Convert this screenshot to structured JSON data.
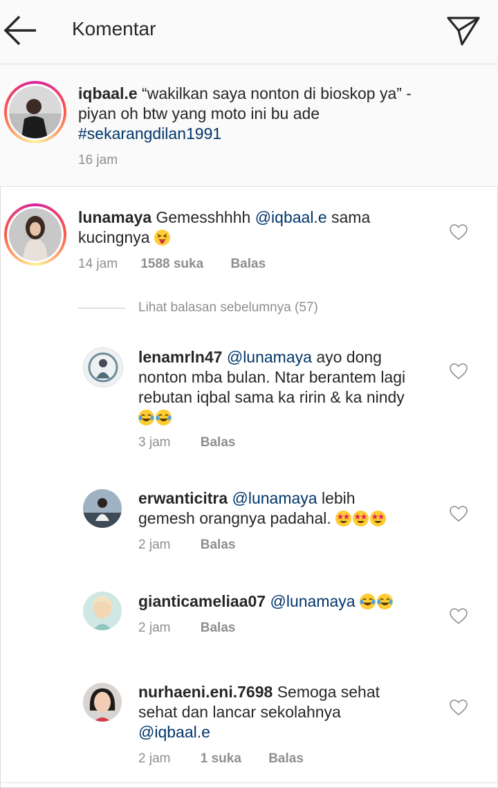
{
  "header": {
    "title": "Komentar",
    "back_icon": "arrow-left-icon",
    "share_icon": "paper-plane-icon"
  },
  "caption": {
    "username": "iqbaal.e",
    "text": "“wakilkan saya nonton di bioskop ya” -piyan oh btw yang moto ini bu ade",
    "hashtag": "#sekarangdilan1991",
    "time": "16 jam"
  },
  "comment": {
    "username": "lunamaya",
    "text_before": "Gemesshhhh",
    "mention": "@iqbaal.e",
    "text_after": "sama kucingnya",
    "emoji": "squinting-tongue-emoji",
    "time": "14 jam",
    "likes": "1588 suka",
    "reply_label": "Balas"
  },
  "view_previous_replies": "Lihat balasan sebelumnya (57)",
  "replies": [
    {
      "username": "lenamrln47",
      "mention": "@lunamaya",
      "text": "ayo dong nonton mba bulan. Ntar berantem lagi rebutan iqbal sama ka ririn & ka nindy",
      "emojis": "tears-of-joy-emoji x2",
      "time": "3 jam",
      "reply_label": "Balas"
    },
    {
      "username": "erwanticitra",
      "mention": "@lunamaya",
      "text": "lebih gemesh orangnya padahal.",
      "emojis": "star-struck-emoji x3",
      "time": "2 jam",
      "reply_label": "Balas"
    },
    {
      "username": "gianticameliaa07",
      "mention": "@lunamaya",
      "emojis": "tears-of-joy-emoji x2",
      "time": "2 jam",
      "reply_label": "Balas"
    },
    {
      "username": "nurhaeni.eni.7698",
      "text": "Semoga sehat sehat dan lancar sekolahnya",
      "mention": "@iqbaal.e",
      "time": "2 jam",
      "likes": "1 suka",
      "reply_label": "Balas"
    }
  ],
  "colors": {
    "link": "#003569",
    "meta_text": "#8e8e8e",
    "header_bg": "#fafafa"
  }
}
